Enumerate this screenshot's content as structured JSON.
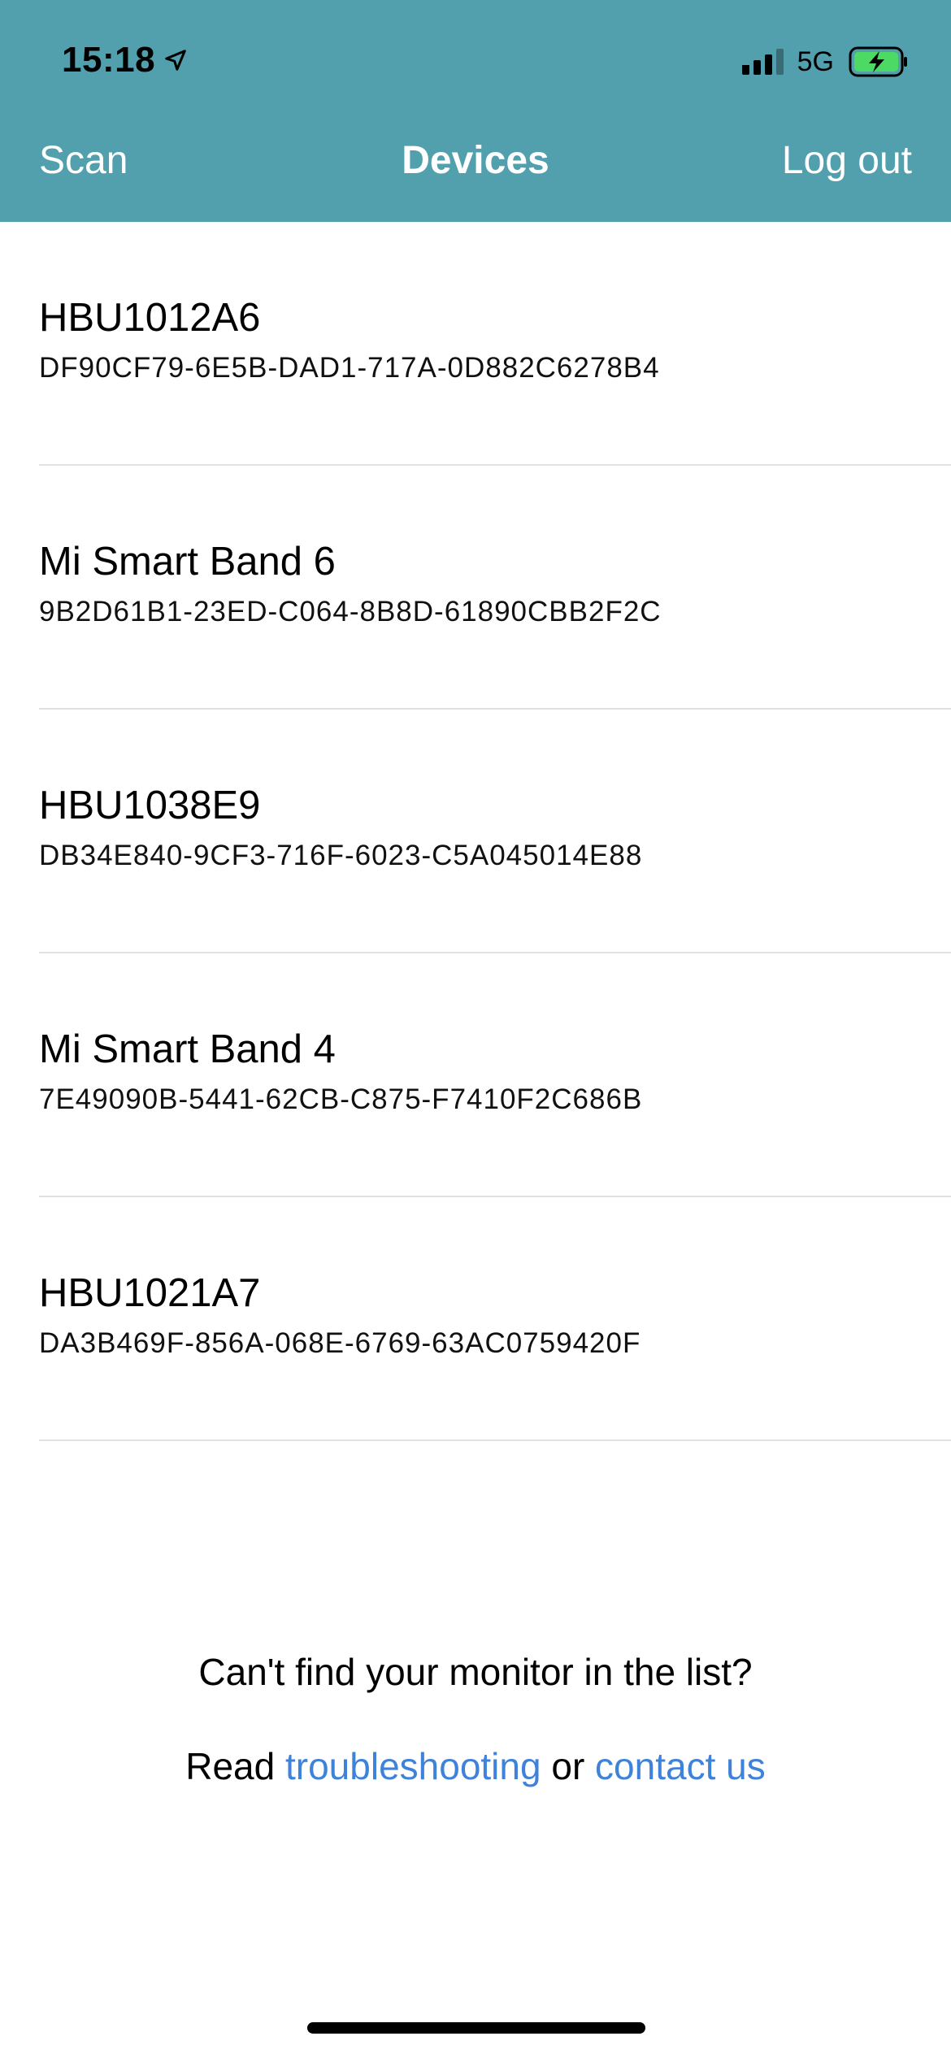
{
  "status_bar": {
    "time": "15:18",
    "network": "5G",
    "icons": [
      "location-arrow-icon",
      "signal-bars-icon",
      "battery-charging-icon"
    ]
  },
  "nav": {
    "left_label": "Scan",
    "title": "Devices",
    "right_label": "Log out"
  },
  "devices": [
    {
      "name": "HBU1012A6",
      "uuid": "DF90CF79-6E5B-DAD1-717A-0D882C6278B4"
    },
    {
      "name": "Mi Smart Band 6",
      "uuid": "9B2D61B1-23ED-C064-8B8D-61890CBB2F2C"
    },
    {
      "name": "HBU1038E9",
      "uuid": "DB34E840-9CF3-716F-6023-C5A045014E88"
    },
    {
      "name": "Mi Smart Band 4",
      "uuid": "7E49090B-5441-62CB-C875-F7410F2C686B"
    },
    {
      "name": "HBU1021A7",
      "uuid": "DA3B469F-856A-068E-6769-63AC0759420F"
    }
  ],
  "help": {
    "question": "Can't find your monitor in the list?",
    "read_prefix": "Read ",
    "troubleshooting_link": "troubleshooting",
    "or_text": " or ",
    "contact_link": "contact us"
  },
  "colors": {
    "header_bg": "#529fad",
    "link": "#3f82d9",
    "battery_fill": "#4cd964"
  }
}
